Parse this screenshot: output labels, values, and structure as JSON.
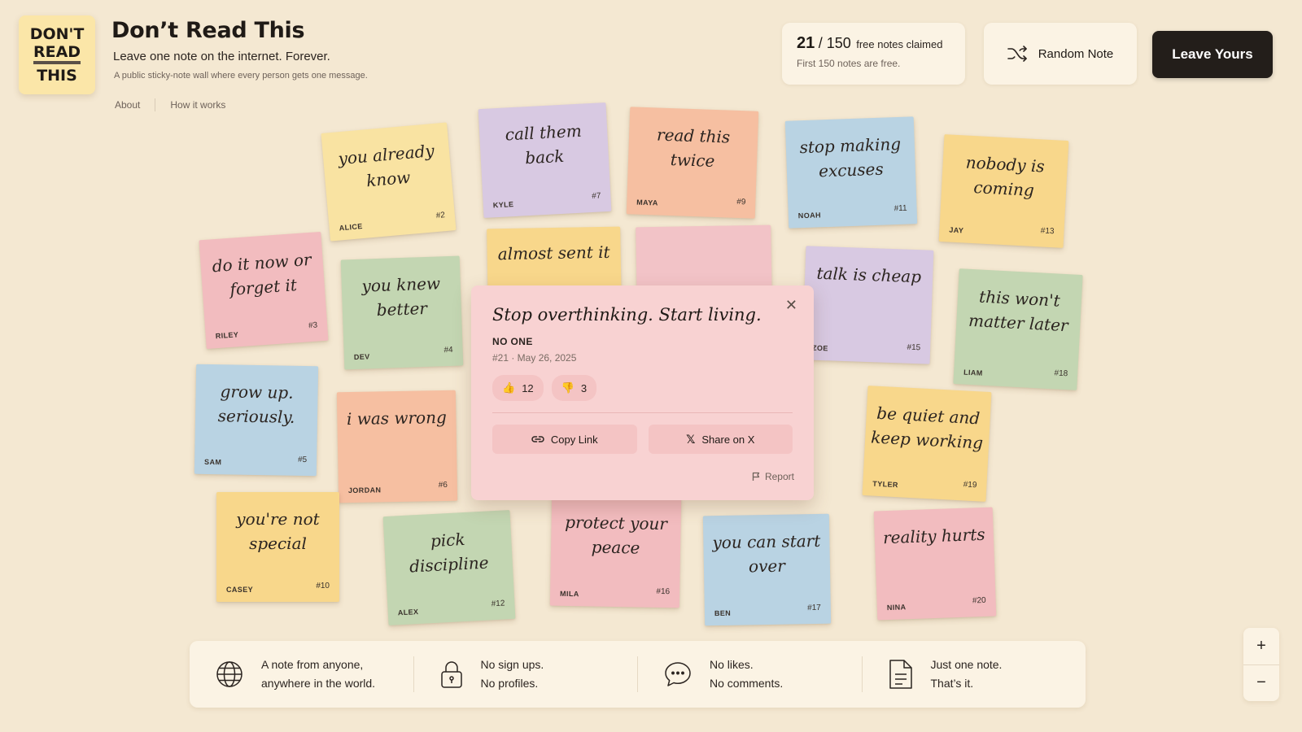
{
  "header": {
    "logo": [
      "DON'T",
      "READ",
      "THIS"
    ],
    "title": "Don’t Read This",
    "tagline": "Leave one note on the internet. Forever.",
    "subtagline": "A public sticky-note wall where every person gets one message.",
    "nav": [
      "About",
      "How it works"
    ]
  },
  "counter": {
    "claimed": "21",
    "total": "/ 150",
    "label": "free notes claimed",
    "subtext": "First 150 notes are free."
  },
  "buttons": {
    "random_note": "Random Note",
    "leave_yours": "Leave Yours"
  },
  "notes": [
    {
      "text": "you already know",
      "author": "ALICE",
      "num": "#2"
    },
    {
      "text": "do it now or forget it",
      "author": "RILEY",
      "num": "#3"
    },
    {
      "text": "you knew better",
      "author": "DEV",
      "num": "#4"
    },
    {
      "text": "grow up. seriously.",
      "author": "SAM",
      "num": "#5"
    },
    {
      "text": "i was wrong",
      "author": "JORDAN",
      "num": "#6"
    },
    {
      "text": "call them back",
      "author": "KYLE",
      "num": "#7"
    },
    {
      "text": "read this twice",
      "author": "MAYA",
      "num": "#9"
    },
    {
      "text": "you're not special",
      "author": "CASEY",
      "num": "#10"
    },
    {
      "text": "stop making excuses",
      "author": "NOAH",
      "num": "#11"
    },
    {
      "text": "pick discipline",
      "author": "ALEX",
      "num": "#12"
    },
    {
      "text": "nobody is coming",
      "author": "JAY",
      "num": "#13"
    },
    {
      "text": "talk is cheap",
      "author": "ZOE",
      "num": "#15"
    },
    {
      "text": "protect your peace",
      "author": "MILA",
      "num": "#16"
    },
    {
      "text": "you can start over",
      "author": "BEN",
      "num": "#17"
    },
    {
      "text": "this won't matter later",
      "author": "LIAM",
      "num": "#18"
    },
    {
      "text": "be quiet and keep working",
      "author": "TYLER",
      "num": "#19"
    },
    {
      "text": "reality hurts",
      "author": "NINA",
      "num": "#20"
    },
    {
      "text": "almost sent it",
      "author": "",
      "num": ""
    },
    {
      "text": "",
      "author": "",
      "num": ""
    }
  ],
  "popup": {
    "message": "Stop overthinking. Start living.",
    "author": "NO ONE",
    "meta": "#21 · May 26, 2025",
    "likes": "12",
    "dislikes": "3",
    "copy_link": "Copy Link",
    "share": "Share on X",
    "report": "Report"
  },
  "features": [
    {
      "icon": "globe-icon",
      "line1": "A note from anyone,",
      "line2": "anywhere in the world."
    },
    {
      "icon": "lock-icon",
      "line1": "No sign ups.",
      "line2": "No profiles."
    },
    {
      "icon": "chat-icon",
      "line1": "No likes.",
      "line2": "No comments."
    },
    {
      "icon": "document-icon",
      "line1": "Just one note.",
      "line2": "That’s it."
    }
  ],
  "zoom": {
    "in": "+",
    "out": "−"
  }
}
